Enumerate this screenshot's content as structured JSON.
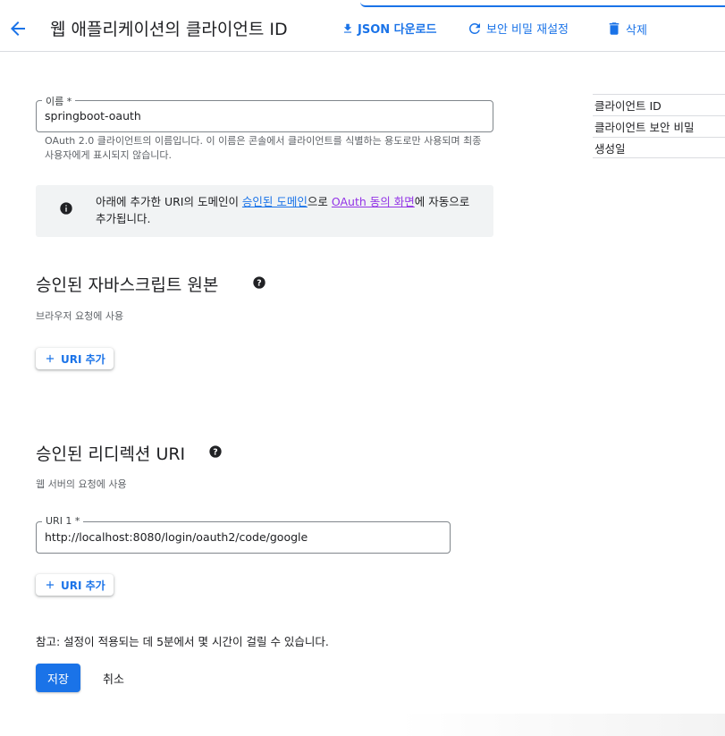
{
  "header": {
    "title": "웹 애플리케이션의 클라이언트 ID",
    "actions": {
      "json_download": "JSON 다운로드",
      "reset_secret": "보안 비밀 재설정",
      "delete": "삭제"
    }
  },
  "name_field": {
    "label": "이름 *",
    "value": "springboot-oauth",
    "help": "OAuth 2.0 클라이언트의 이름입니다. 이 이름은 콘솔에서 클라이언트를 식별하는 용도로만 사용되며 최종 사용자에게 표시되지 않습니다."
  },
  "info_box": {
    "text_before": "아래에 추가한 URI의 도메인이 ",
    "link1": "승인된 도메인",
    "text_middle": "으로 ",
    "link2": "OAuth 동의 화면",
    "text_after": "에 자동으로 추가됩니다."
  },
  "js_origins": {
    "title": "승인된 자바스크립트 원본",
    "subtitle": "브라우저 요청에 사용",
    "add_button": "URI 추가"
  },
  "redirect_uris": {
    "title": "승인된 리디렉션 URI",
    "subtitle": "웹 서버의 요청에 사용",
    "uri1_label": "URI 1 *",
    "uri1_value": "http://localhost:8080/login/oauth2/code/google",
    "add_button": "URI 추가"
  },
  "note": "참고: 설정이 적용되는 데 5분에서 몇 시간이 걸릴 수 있습니다.",
  "buttons": {
    "save": "저장",
    "cancel": "취소"
  },
  "side_table": {
    "rows": [
      "클라이언트 ID",
      "클라이언트 보안 비밀",
      "생성일"
    ]
  },
  "colors": {
    "accent": "#1a73e8",
    "visited_link": "#9334e6",
    "info_bg": "#f1f3f4"
  }
}
